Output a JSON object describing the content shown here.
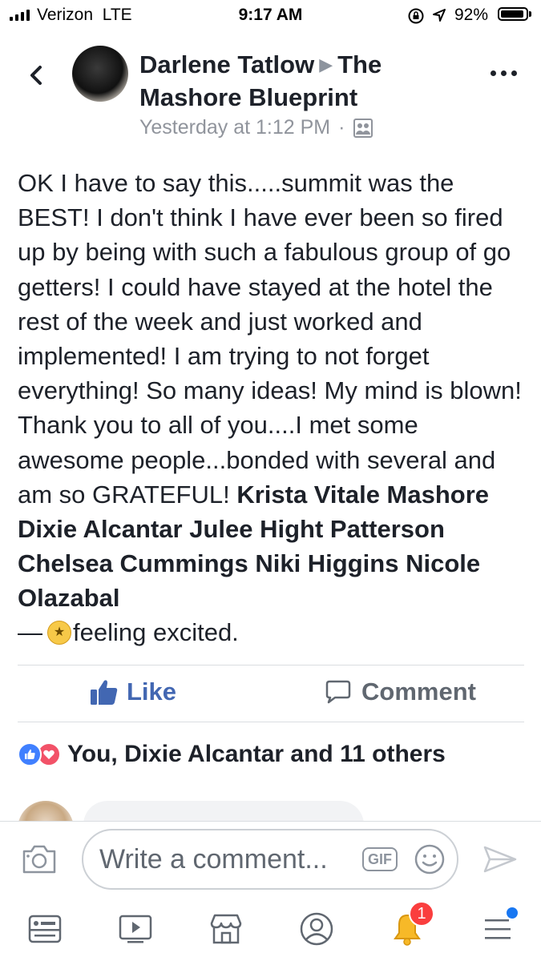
{
  "status_bar": {
    "carrier": "Verizon",
    "network": "LTE",
    "time": "9:17 AM",
    "battery": "92%",
    "battery_level": 0.92
  },
  "header": {
    "author": "Darlene Tatlow",
    "arrow": "▶",
    "group": "The Mashore Blueprint",
    "timestamp": "Yesterday at 1:12 PM",
    "separator": "·",
    "audience_icon": "group-icon"
  },
  "post": {
    "text": "OK I have to say this.....summit was the BEST!  I don't think I have ever been so fired up by being with such a fabulous group of go getters!  I could have stayed at the hotel the rest of the week and just worked and implemented!  I am trying to not forget everything!  So many ideas!  My mind is blown!  Thank you to all of you....I met some awesome people...bonded with several and am so GRATEFUL! ",
    "tags": [
      "Krista Vitale Mashore",
      "Dixie Alcantar",
      "Julee Hight Patterson",
      "Chelsea Cummings",
      "Niki Higgins",
      "Nicole Olazabal"
    ],
    "feeling_dash": "—",
    "feeling": "feeling excited."
  },
  "actions": {
    "like": "Like",
    "comment": "Comment"
  },
  "reactions": {
    "summary": "You, Dixie Alcantar and 11 others"
  },
  "composer": {
    "placeholder": "Write a comment...",
    "gif": "GIF"
  },
  "tabbar": {
    "notifications_badge": "1",
    "tabs": [
      "news-feed-icon",
      "watch-icon",
      "marketplace-icon",
      "profile-icon",
      "notifications-icon",
      "menu-icon"
    ]
  },
  "colors": {
    "link_blue": "#4267b2",
    "secondary_text": "#90949c",
    "badge_red": "#fa3e3e"
  }
}
